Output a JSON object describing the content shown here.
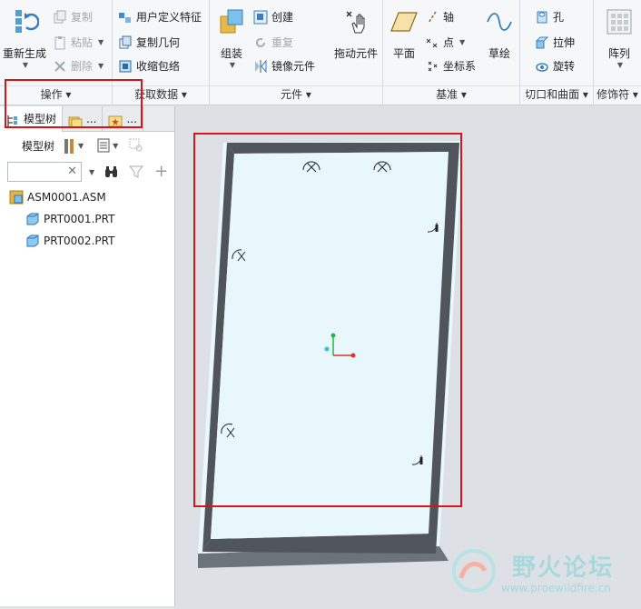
{
  "ribbon": {
    "operations": {
      "regenerate": "重新生成",
      "copy": "复制",
      "paste": "粘贴",
      "delete": "删除",
      "label": "操作"
    },
    "get_data": {
      "udf": "用户定义特征",
      "copy_geom": "复制几何",
      "shrinkwrap": "收缩包络",
      "label": "获取数据"
    },
    "component": {
      "assemble": "组装",
      "create": "创建",
      "repeat": "重复",
      "mirror": "镜像元件",
      "drag": "拖动元件",
      "label": "元件"
    },
    "datum": {
      "plane": "平面",
      "axis": "轴",
      "point": "点",
      "csys": "坐标系",
      "sketch": "草绘",
      "label": "基准"
    },
    "cut_surface": {
      "hole": "孔",
      "extrude": "拉伸",
      "revolve": "旋转",
      "label": "切口和曲面"
    },
    "modifiers": {
      "pattern": "阵列",
      "label": "修饰符"
    }
  },
  "left_panel": {
    "tabs": [
      "模型树",
      "...",
      "..."
    ],
    "tree_toolbar_label": "模型树",
    "search_value": "",
    "tree": [
      {
        "label": "ASM0001.ASM"
      },
      {
        "label": "PRT0001.PRT"
      },
      {
        "label": "PRT0002.PRT"
      }
    ]
  },
  "watermark": {
    "title": "野火论坛",
    "url": "www.proewildfire.cn"
  },
  "colors": {
    "plate": "#e8f7fb",
    "frame": "#4f555b",
    "highlight": "#d4161a",
    "csys_x": "#e0302a",
    "csys_y": "#2bb24c",
    "csys_z": "#2ec3e0"
  }
}
